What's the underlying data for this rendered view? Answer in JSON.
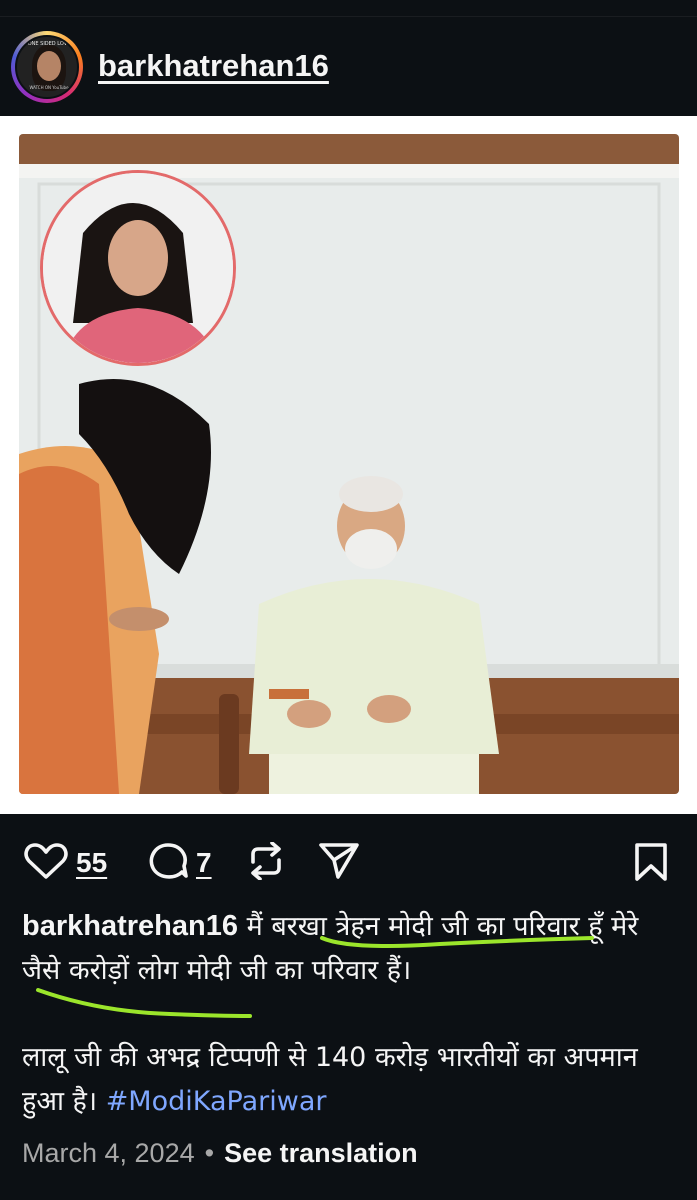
{
  "post": {
    "username": "barkhatrehan16",
    "avatar_brand": "ONE SIDED LOVE",
    "avatar_footer": "WATCH ON YouTube",
    "likes": "55",
    "comments": "7",
    "caption_line1": "मैं बरखा त्रेहन मोदी जी का परिवार हूँ मेरे जैसे करोड़ों लोग मोदी जी का परिवार हैं।",
    "caption_line2": "लालू जी की अभद्र टिप्पणी से 140 करोड़ भारतीयों का अपमान हुआ है।",
    "hashtag": "#ModiKaPariwar",
    "date": "March 4, 2024",
    "separator": "•",
    "see_translation": "See translation"
  },
  "icons": {
    "like": "heart-icon",
    "comment": "comment-icon",
    "repost": "repost-icon",
    "share": "share-icon",
    "save": "bookmark-icon"
  },
  "colors": {
    "background": "#0c1014",
    "text": "#f5f5f5",
    "hashtag": "#7fa7ff",
    "muted": "#a8a8a8",
    "highlight": "#9be52b",
    "inset_ring": "#e36a6a"
  }
}
